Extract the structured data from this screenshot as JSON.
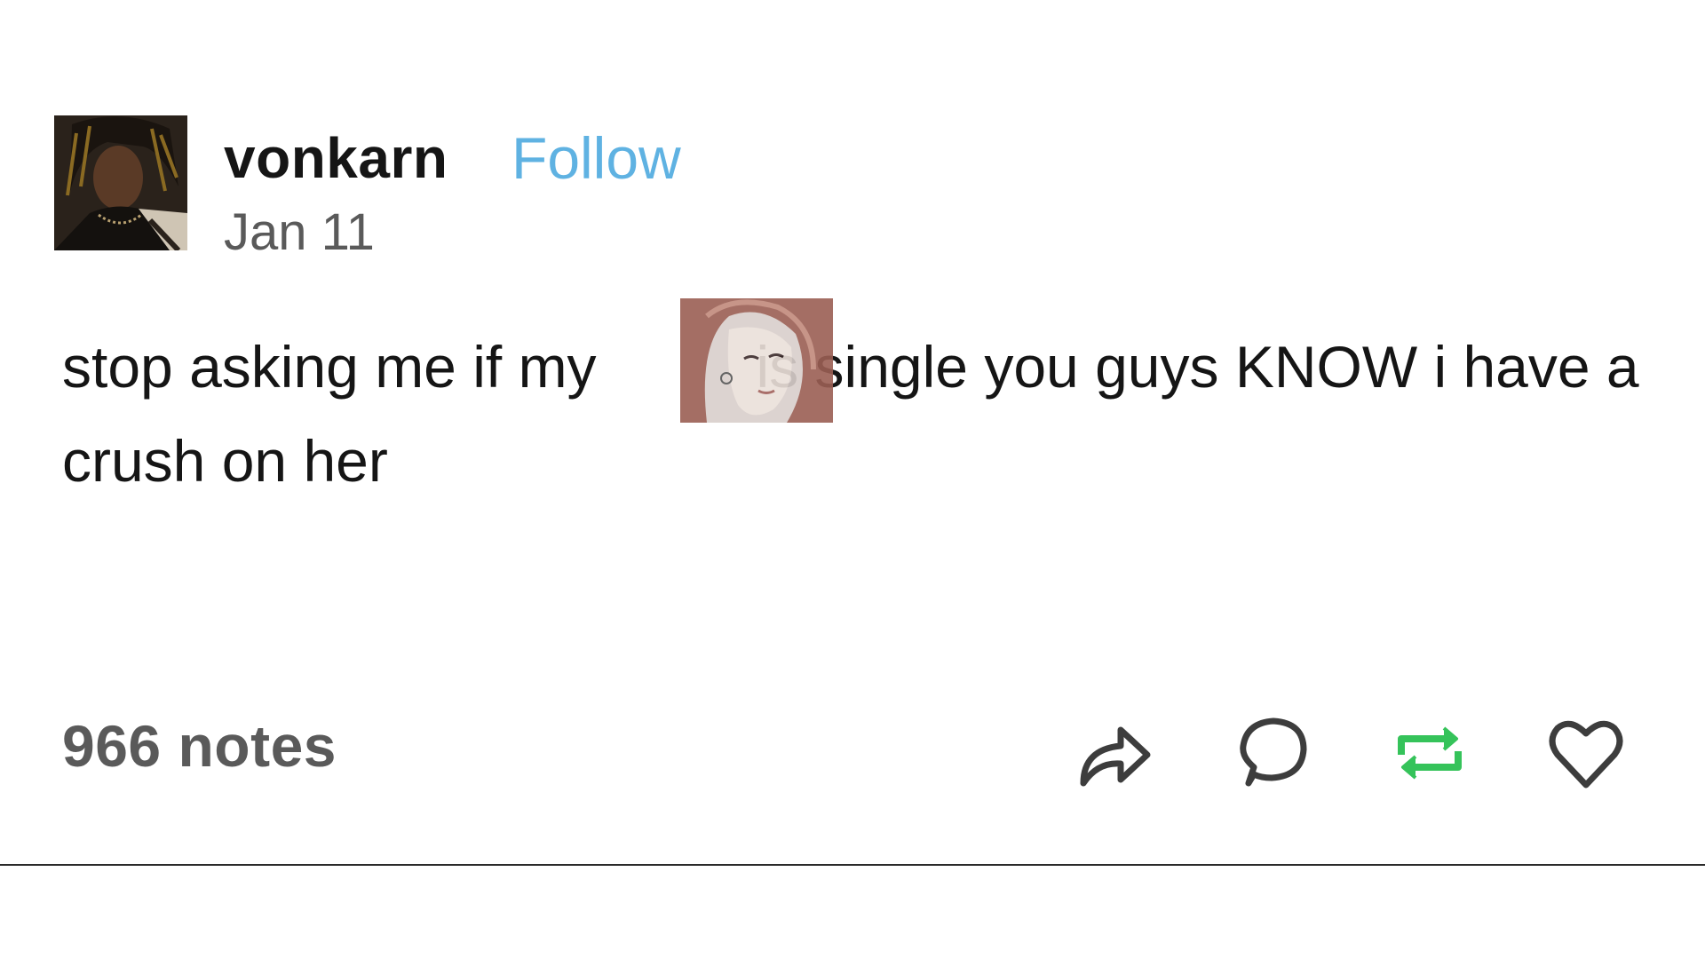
{
  "post": {
    "author": "vonkarn",
    "follow_label": "Follow",
    "date": "Jan 11",
    "text_before_image": "stop asking me if my",
    "text_after_image": "is single you guys KNOW i have a crush on her",
    "notes": "966 notes"
  },
  "actions": {
    "share_icon": "share-icon",
    "reply_icon": "reply-icon",
    "reblog_icon": "reblog-icon",
    "like_icon": "heart-icon"
  },
  "colors": {
    "follow": "#5fb2e2",
    "reblog": "#35c35a",
    "icon": "#3d3d3d",
    "muted_text": "#5a5a5a"
  }
}
